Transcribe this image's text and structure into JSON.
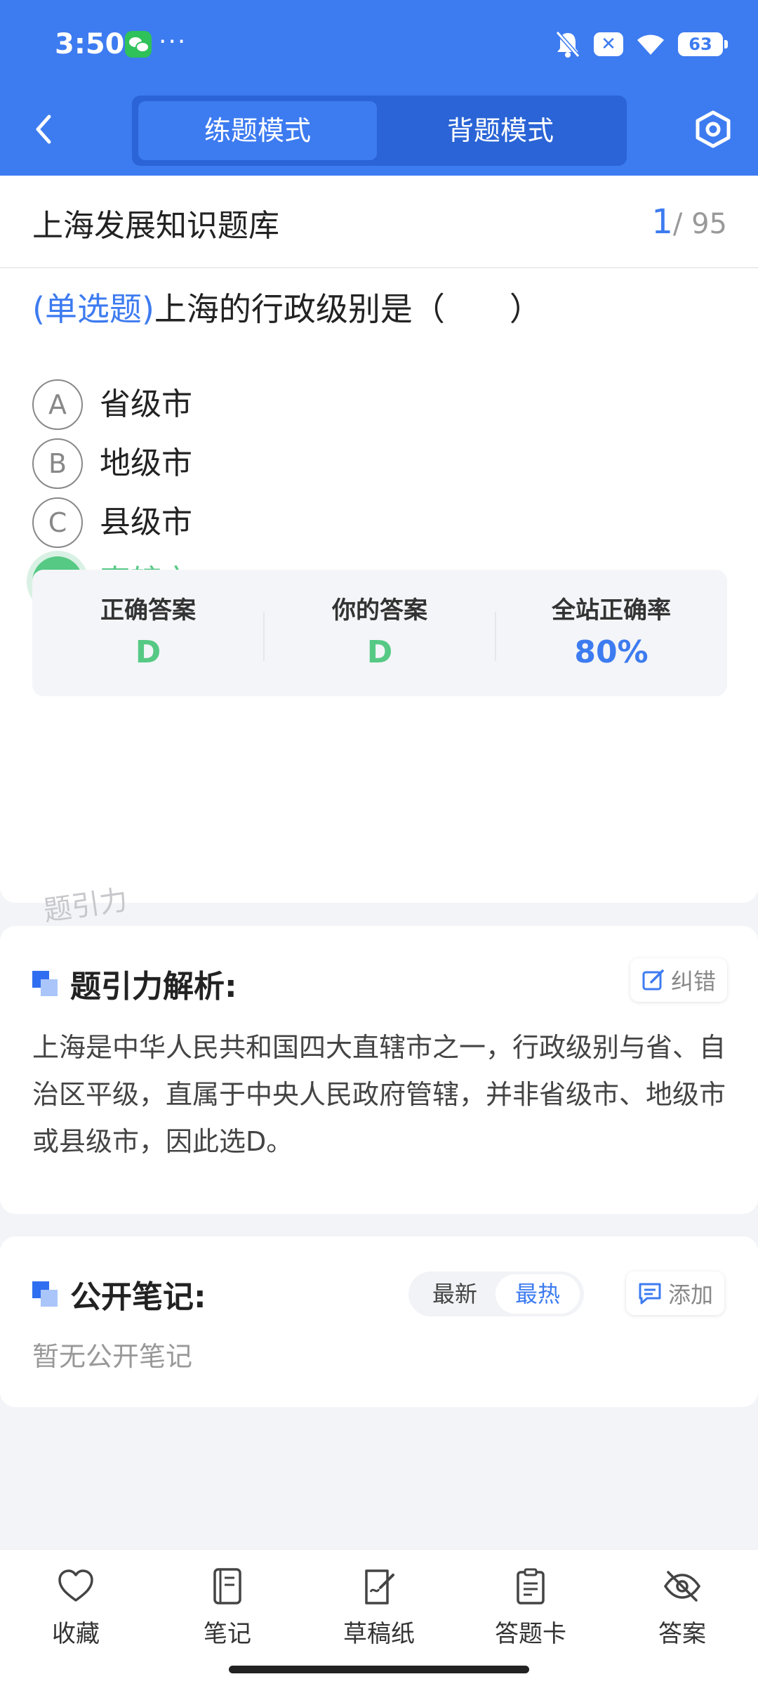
{
  "status_bar": {
    "time": "3:50",
    "more": "···",
    "close_badge": "✕",
    "battery": "63"
  },
  "header": {
    "tabs": [
      {
        "label": "练题模式",
        "active": true
      },
      {
        "label": "背题模式",
        "active": false
      }
    ],
    "accent_color": "#3d7bf0"
  },
  "question": {
    "bank_title": "上海发展知识题库",
    "current": "1",
    "total": "/ 95",
    "type_label": "(单选题)",
    "stem": "上海的行政级别是（　　）",
    "options": [
      {
        "letter": "A",
        "text": "省级市"
      },
      {
        "letter": "B",
        "text": "地级市"
      },
      {
        "letter": "C",
        "text": "县级市"
      },
      {
        "letter": "D",
        "text": "直辖市",
        "state": "correct"
      }
    ],
    "result": {
      "correct_label": "正确答案",
      "correct_value": "D",
      "yours_label": "你的答案",
      "yours_value": "D",
      "rate_label": "全站正确率",
      "rate_value": "80%"
    }
  },
  "watermark": "题引力",
  "analysis": {
    "title": "题引力解析:",
    "report_label": "纠错",
    "text": "上海是中华人民共和国四大直辖市之一，行政级别与省、自治区平级，直属于中央人民政府管辖，并非省级市、地级市或县级市，因此选D。"
  },
  "notes": {
    "title": "公开笔记:",
    "sort_latest": "最新",
    "sort_hot": "最热",
    "add_label": "添加",
    "empty_text": "暂无公开笔记"
  },
  "bottom_nav": [
    {
      "label": "收藏",
      "icon": "heart-icon"
    },
    {
      "label": "笔记",
      "icon": "notebook-icon"
    },
    {
      "label": "草稿纸",
      "icon": "draft-paper-icon"
    },
    {
      "label": "答题卡",
      "icon": "answer-sheet-icon"
    },
    {
      "label": "答案",
      "icon": "eye-off-icon"
    }
  ]
}
